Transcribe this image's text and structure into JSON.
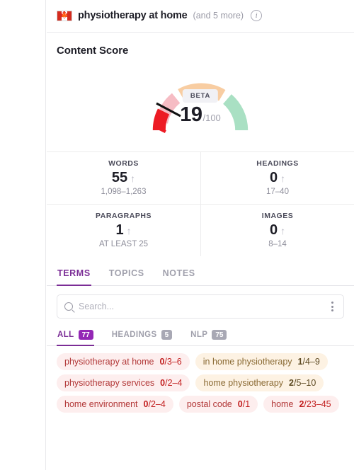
{
  "header": {
    "flag_icon": "canada-flag",
    "title": "physiotherapy at home",
    "more": "(and 5 more)",
    "info_icon": "info-icon"
  },
  "content_score": {
    "section_title": "Content Score",
    "beta_label": "BETA",
    "score": "19",
    "score_denominator": "/100",
    "gauge": {
      "value": 19,
      "max": 100,
      "segments": [
        {
          "name": "filled",
          "color": "#ed1b24",
          "from": 0,
          "to": 19
        },
        {
          "name": "poor",
          "color": "#f6bcc4",
          "from": 19,
          "to": 33
        },
        {
          "name": "average",
          "color": "#f8cda2",
          "from": 34,
          "to": 66
        },
        {
          "name": "good",
          "color": "#a9e0c3",
          "from": 67,
          "to": 100
        }
      ]
    }
  },
  "stats": [
    {
      "label": "WORDS",
      "value": "55",
      "trend_icon": "arrow-up-icon",
      "range": "1,098–1,263"
    },
    {
      "label": "HEADINGS",
      "value": "0",
      "trend_icon": "arrow-up-icon",
      "range": "17–40"
    },
    {
      "label": "PARAGRAPHS",
      "value": "1",
      "trend_icon": "arrow-up-icon",
      "range": "AT LEAST 25"
    },
    {
      "label": "IMAGES",
      "value": "0",
      "trend_icon": "arrow-up-icon",
      "range": "8–14"
    }
  ],
  "tabs": [
    {
      "label": "TERMS",
      "active": true
    },
    {
      "label": "TOPICS",
      "active": false
    },
    {
      "label": "NOTES",
      "active": false
    }
  ],
  "search": {
    "icon": "search-icon",
    "value": "",
    "placeholder": "Search...",
    "menu_icon": "kebab-menu-icon"
  },
  "subtabs": [
    {
      "label": "ALL",
      "count": "77",
      "active": true
    },
    {
      "label": "HEADINGS",
      "count": "5",
      "active": false
    },
    {
      "label": "NLP",
      "count": "75",
      "active": false
    }
  ],
  "terms": [
    {
      "name": "physiotherapy at home",
      "used": "0",
      "target": "/3–6",
      "status": "red"
    },
    {
      "name": "in home physiotherapy",
      "used": "1",
      "target": "/4–9",
      "status": "orange"
    },
    {
      "name": "physiotherapy services",
      "used": "0",
      "target": "/2–4",
      "status": "red"
    },
    {
      "name": "home physiotherapy",
      "used": "2",
      "target": "/5–10",
      "status": "orange"
    },
    {
      "name": "home environment",
      "used": "0",
      "target": "/2–4",
      "status": "red"
    },
    {
      "name": "postal code",
      "used": "0",
      "target": "/1",
      "status": "red"
    },
    {
      "name": "home",
      "used": "2",
      "target": "/23–45",
      "status": "red"
    }
  ],
  "colors": {
    "accent_purple": "#7b2d96",
    "badge_purple": "#9427b5",
    "gauge_red": "#ed1b24",
    "gauge_pink": "#f6bcc4",
    "gauge_orange": "#f8cda2",
    "gauge_green": "#a9e0c3"
  }
}
